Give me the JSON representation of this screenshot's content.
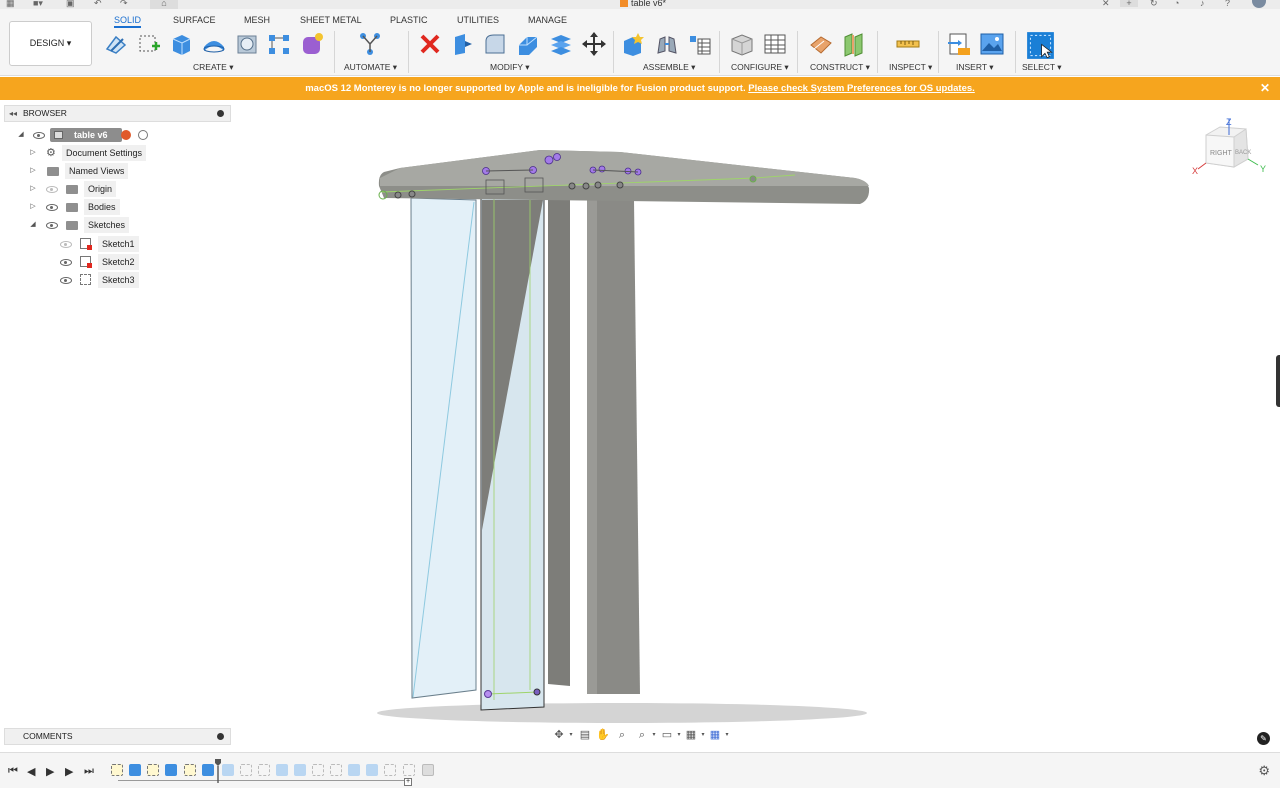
{
  "window": {
    "title": "table v6*"
  },
  "toolbar": {
    "design_label": "DESIGN ▾",
    "tabs": [
      {
        "label": "SOLID",
        "active": true
      },
      {
        "label": "SURFACE",
        "active": false
      },
      {
        "label": "MESH",
        "active": false
      },
      {
        "label": "SHEET METAL",
        "active": false
      },
      {
        "label": "PLASTIC",
        "active": false
      },
      {
        "label": "UTILITIES",
        "active": false
      },
      {
        "label": "MANAGE",
        "active": false
      }
    ],
    "groups": {
      "create": "CREATE ▾",
      "automate": "AUTOMATE ▾",
      "modify": "MODIFY ▾",
      "assemble": "ASSEMBLE ▾",
      "configure": "CONFIGURE ▾",
      "construct": "CONSTRUCT ▾",
      "inspect": "INSPECT ▾",
      "insert": "INSERT ▾",
      "select": "SELECT ▾"
    }
  },
  "banner": {
    "message": "macOS 12 Monterey is no longer supported by Apple and is ineligible for Fusion product support. ",
    "link": "Please check System Preferences for OS updates.",
    "close": "✕"
  },
  "browser": {
    "header": "BROWSER",
    "root": "table v6",
    "items": [
      {
        "label": "Document Settings"
      },
      {
        "label": "Named Views"
      },
      {
        "label": "Origin"
      },
      {
        "label": "Bodies"
      },
      {
        "label": "Sketches"
      }
    ],
    "sketches": [
      {
        "label": "Sketch1"
      },
      {
        "label": "Sketch2"
      },
      {
        "label": "Sketch3"
      }
    ]
  },
  "comments": {
    "header": "COMMENTS"
  },
  "viewcube": {
    "z": "Z",
    "x": "X",
    "y": "Y",
    "right": "RIGHT",
    "back": "BACK"
  },
  "colors": {
    "accent": "#1a6fd0",
    "banner": "#f6a51e",
    "body": "#8a8a86",
    "sketch_line": "#9ed46a"
  },
  "icons": {
    "top_left": [
      "apps-icon",
      "file-icon",
      "save-icon",
      "undo-icon",
      "redo-icon",
      "home-icon"
    ],
    "top_right": [
      "close-tab-icon",
      "add-tab-icon",
      "refresh-icon",
      "clock-icon",
      "bell-icon",
      "help-icon",
      "avatar"
    ]
  }
}
